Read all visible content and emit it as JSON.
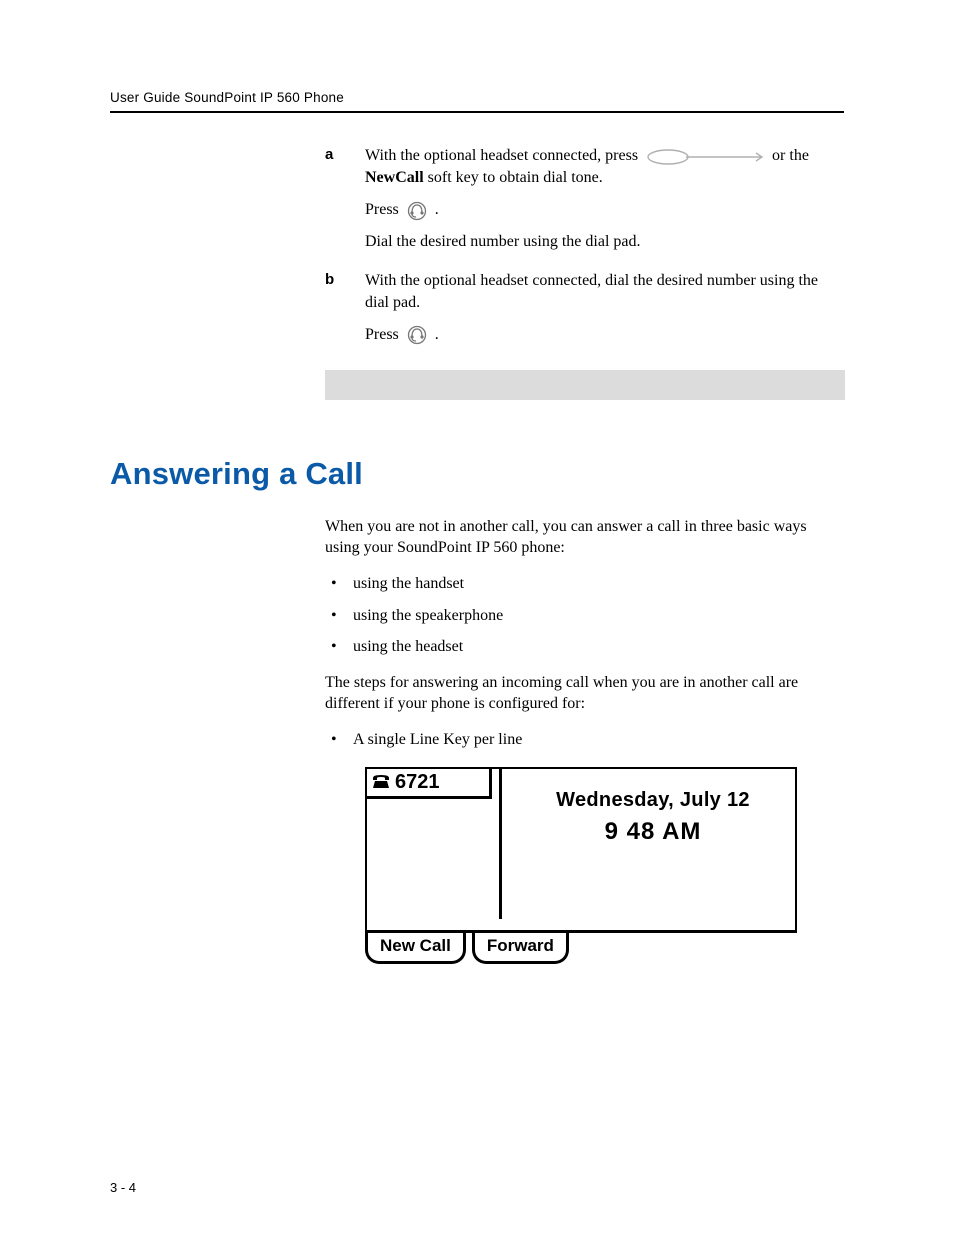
{
  "runningHead": "User Guide SoundPoint IP 560 Phone",
  "steps": {
    "a": {
      "marker": "a",
      "line1a": "With the optional headset connected, press ",
      "line1b": " or the ",
      "newcall_bold": "NewCall",
      "line1c": " soft key to obtain dial tone.",
      "press": "Press ",
      "dot1": " .",
      "dial": "Dial the desired number using the dial pad."
    },
    "b": {
      "marker": "b",
      "line1": "With the optional headset connected, dial the desired number using the dial pad.",
      "press": "Press ",
      "dot1": " ."
    }
  },
  "heading": "Answering a Call",
  "intro1": "When you are not in another call, you can answer a call in three basic ways using your SoundPoint IP 560 phone:",
  "bullets1": [
    "using the handset",
    "using the speakerphone",
    "using the headset"
  ],
  "intro2": "The steps for answering an incoming call when you are in another call are different if your phone is configured for:",
  "bullets2": [
    "A single Line Key per line"
  ],
  "phone": {
    "line_number": "6721",
    "date": "Wednesday, July 12",
    "time": "9 48 AM",
    "softkeys": [
      "New Call",
      "Forward"
    ]
  },
  "pageNum": "3 - 4",
  "chart_data": null
}
